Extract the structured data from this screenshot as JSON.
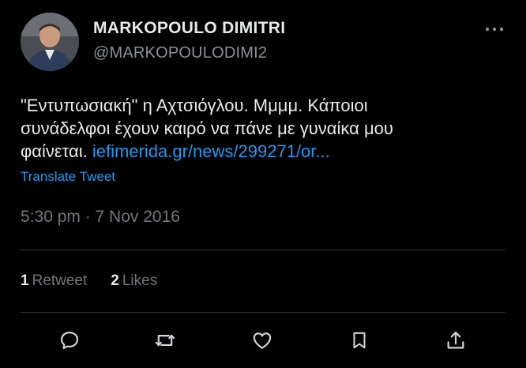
{
  "user": {
    "display_name": "MARKOPOULO DIMITRI",
    "handle": "@MARKOPOULODIMI2"
  },
  "tweet": {
    "lines": [
      "\"Εντυπωσιακή\" η Αχτσιόγλου. Μμμμ. Κάποιοι",
      "συνάδελφοι έχουν καιρό να πάνε με γυναίκα μου",
      "φαίνεται."
    ],
    "link_text": "iefimerida.gr/news/299271/or...",
    "translate_label": "Translate Tweet",
    "timestamp": "5:30 pm · 7 Nov 2016"
  },
  "stats": {
    "retweets_count": "1",
    "retweets_label": "Retweet",
    "likes_count": "2",
    "likes_label": "Likes"
  },
  "actions": {
    "icons": [
      "reply-icon",
      "retweet-icon",
      "like-icon",
      "bookmark-icon",
      "share-icon"
    ]
  },
  "colors": {
    "background": "#000000",
    "text": "#e7e9ea",
    "secondary": "#71767b",
    "link": "#1d9bf0",
    "divider": "#2f3336"
  }
}
